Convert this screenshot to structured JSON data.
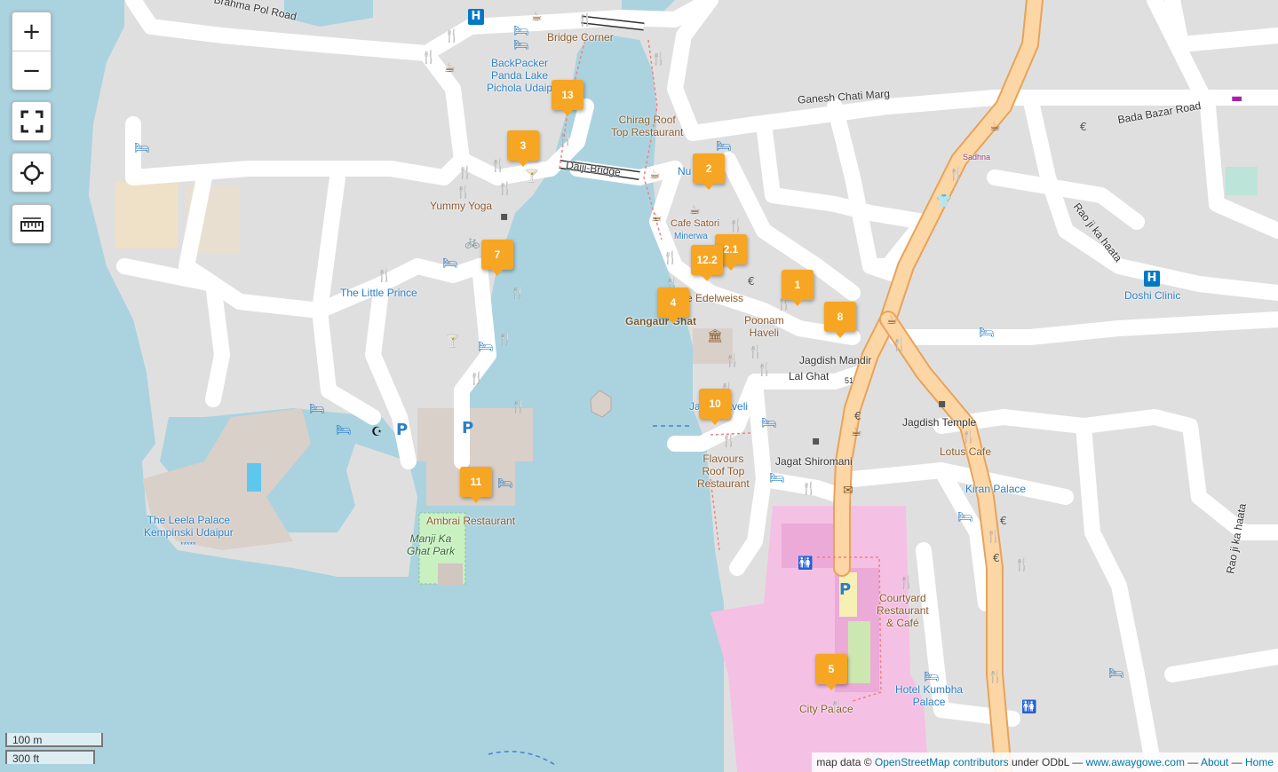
{
  "map": {
    "labels": {
      "brahma_pol_road": "Brahma Pol Road",
      "bridge_corner": "Bridge Corner",
      "backpacker": "BackPacker\nPanda Lake\nPichola Udaip",
      "chirag": "Chirag Roof\nTop Restaurant",
      "ganesh_chati": "Ganesh Chati Marg",
      "bada_bazar": "Bada Bazar Road",
      "sadhna": "Sadhna",
      "daiji_bridge": "Daiji-Bridge",
      "yummy_yoga": "Yummy Yoga",
      "cafe_satori": "Cafe Satori",
      "minerwa": "Minerwa",
      "nu": "Nu",
      "edelweiss": "e Edelweiss",
      "rao_ji_ka_haata_1": "Rao ji ka haata",
      "doshi_clinic": "Doshi Clinic",
      "the_little_prince": "The Little Prince",
      "gangaur_ghat": "Gangaur Ghat",
      "poonam_haveli": "Poonam\nHaveli",
      "jagdish_mandir": "Jagdish Mandir",
      "lal_ghat": "Lal Ghat",
      "jagat_haveli": "Jagat Haveli",
      "jagdish_temple": "Jagdish Temple",
      "lotus_cafe": "Lotus Cafe",
      "flavours": "Flavours\nRoof Top\nRestaurant",
      "jagat_shiromani": "Jagat Shiromani",
      "kiran_palace": "Kiran Palace",
      "leela_palace": "The Leela Palace\nKempinski Udaipur",
      "leela_stars": "*****",
      "ambrai": "Ambrai Restaurant",
      "manji_ka_ghat_park": "Manji Ka\nGhat Park",
      "rao_ji_ka_haata_2": "Rao ji ka haata",
      "courtyard": "Courtyard\nRestaurant\n& Café",
      "hotel_kumbha": "Hotel Kumbha\nPalace",
      "city_palace": "City Palace",
      "lal_ghat_no": "51"
    },
    "markers": [
      "13",
      "3",
      "2",
      "2.1",
      "12.2",
      "7",
      "1",
      "4",
      "8",
      "10",
      "11",
      "5"
    ],
    "icons": [
      "hospital-icon",
      "restaurant-icon",
      "cafe-icon",
      "hotel-icon",
      "bar-icon",
      "parking-icon",
      "mosque-icon",
      "atm-icon",
      "toilets-icon",
      "post-office-icon",
      "shop-icon",
      "bicycle-icon",
      "museum-icon"
    ]
  },
  "controls": {
    "zoom_in": "+",
    "zoom_out": "−"
  },
  "scale": {
    "metric": "100 m",
    "imperial": "300 ft"
  },
  "attribution": {
    "prefix": "map data © ",
    "osm_link": "OpenStreetMap contributors",
    "license": " under ODbL — ",
    "site_link": "www.awaygowe.com",
    "sep1": " — ",
    "about_link": "About",
    "sep2": " — ",
    "home_link": "Home"
  },
  "colors": {
    "water": "#aad3df",
    "land": "#e0dfdf",
    "road": "#ffffff",
    "primary_road": "#fcd6a4",
    "marker": "#f6a623",
    "palace": "#f4c0e4"
  }
}
